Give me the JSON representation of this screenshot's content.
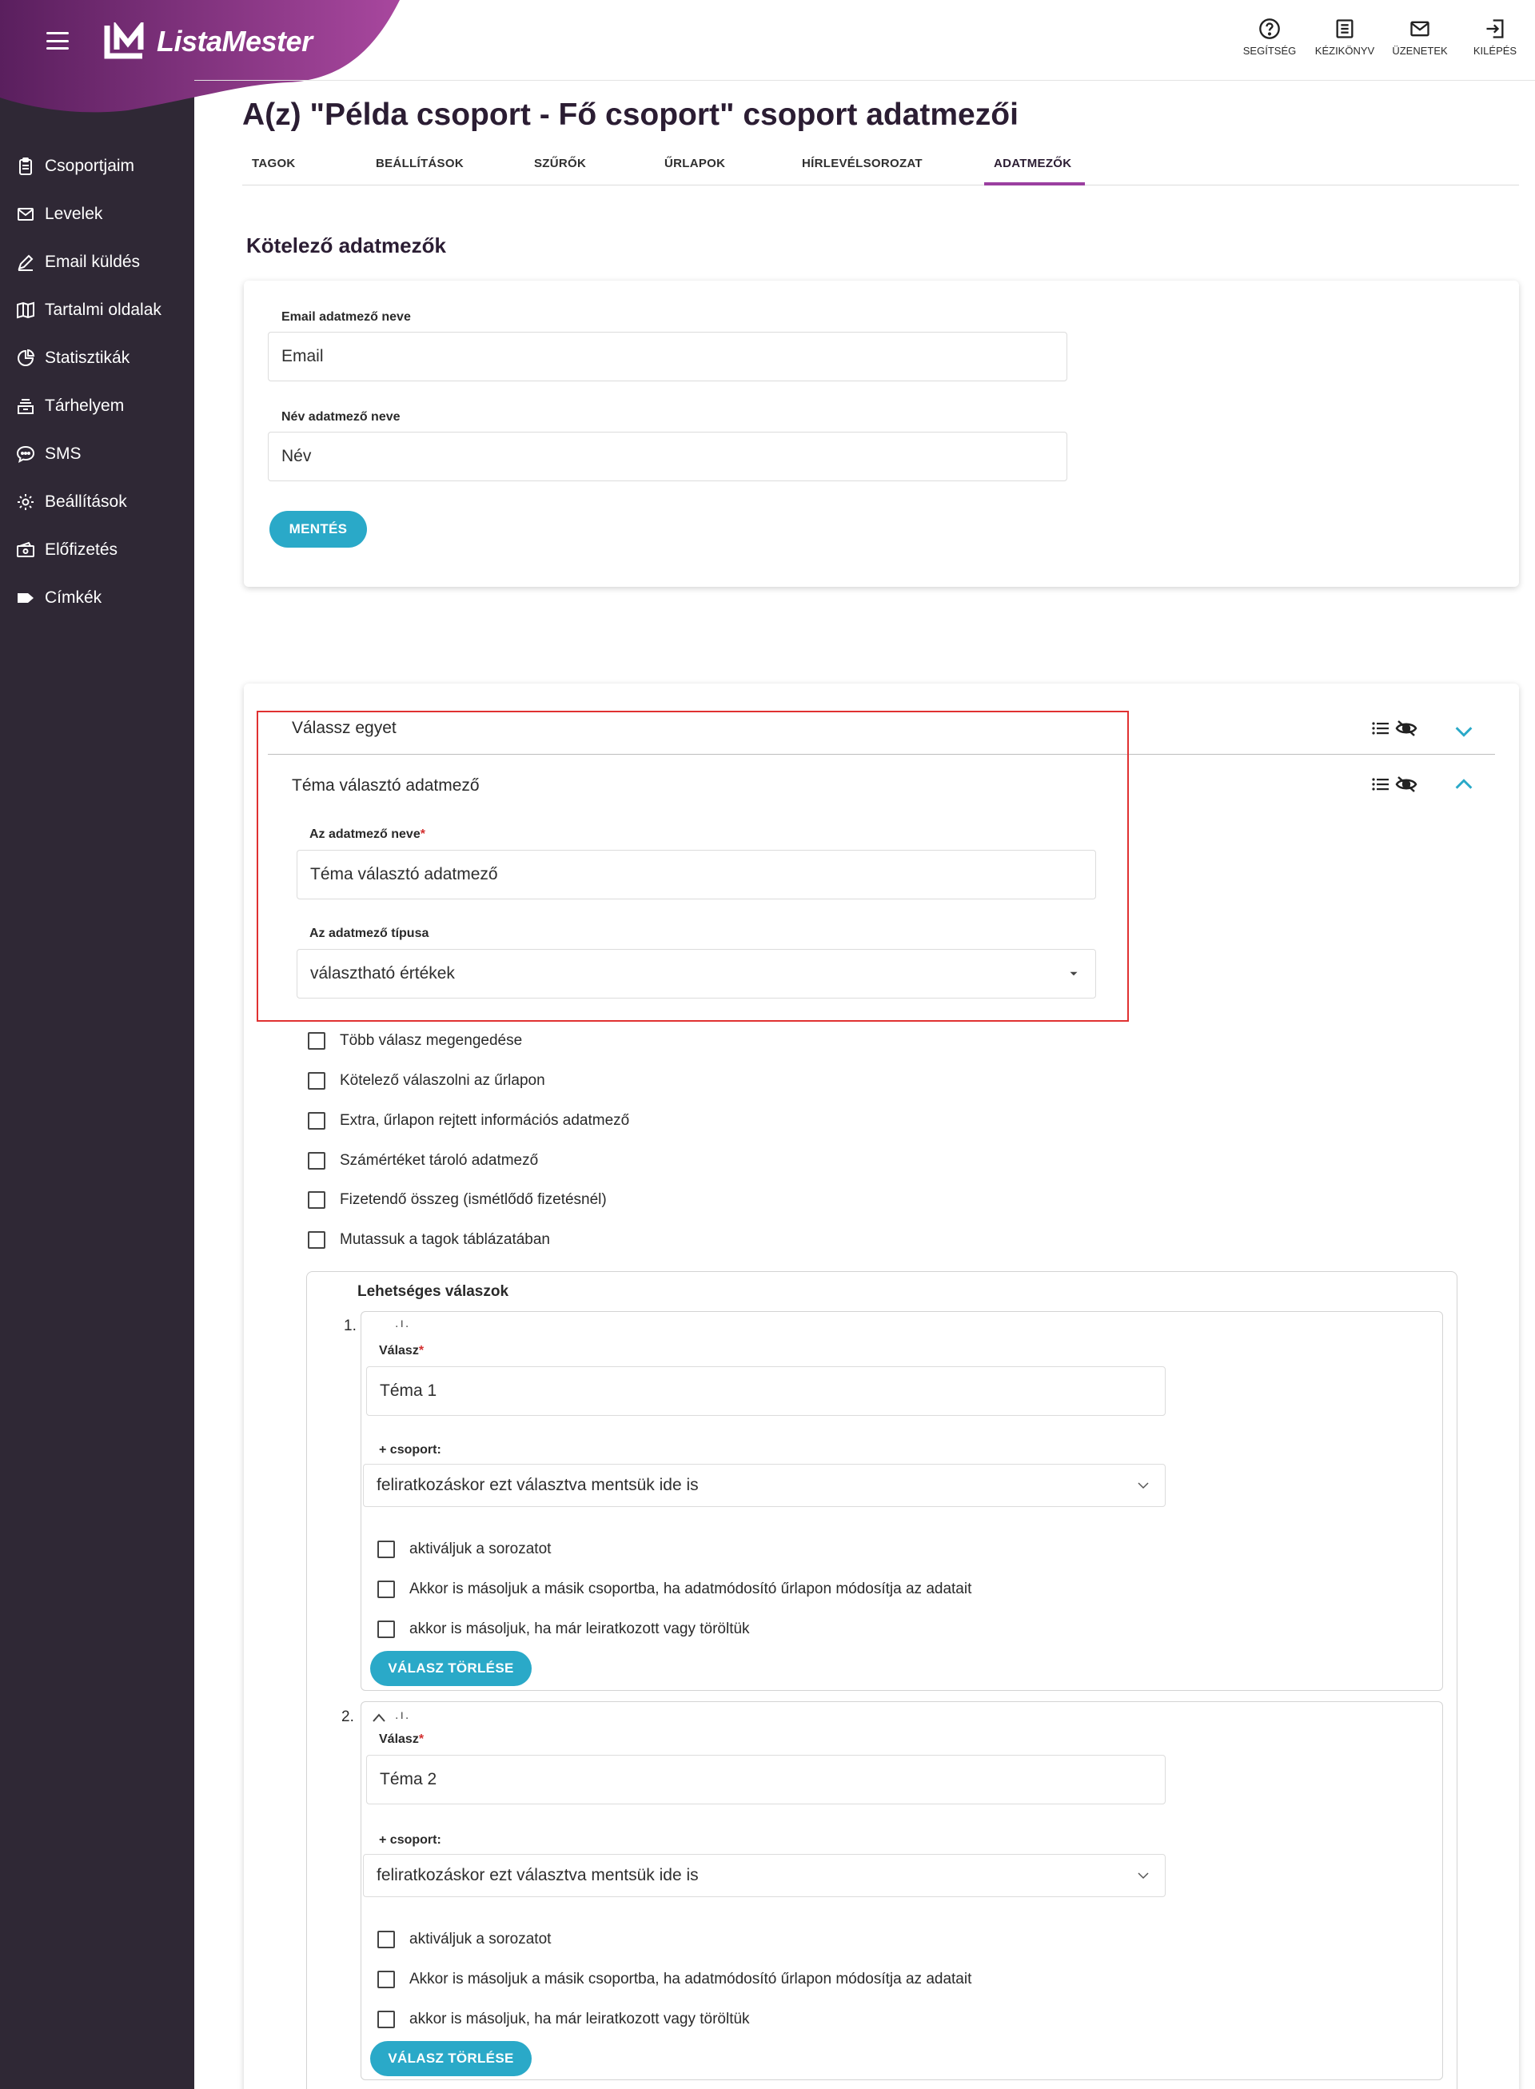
{
  "brand": {
    "name": "ListaMester",
    "colors": {
      "sidebar": "#2f2835",
      "brand_purple": "#9b3fa0",
      "accent": "#2aa9c8",
      "highlight": "#e03131"
    }
  },
  "sidebar": {
    "items": [
      {
        "label": "Csoportjaim",
        "icon": "clipboard-icon"
      },
      {
        "label": "Levelek",
        "icon": "mail-icon"
      },
      {
        "label": "Email küldés",
        "icon": "pen-icon"
      },
      {
        "label": "Tartalmi oldalak",
        "icon": "book-icon"
      },
      {
        "label": "Statisztikák",
        "icon": "pie-chart-icon"
      },
      {
        "label": "Tárhelyem",
        "icon": "storage-icon"
      },
      {
        "label": "SMS",
        "icon": "chat-icon"
      },
      {
        "label": "Beállítások",
        "icon": "gear-icon"
      },
      {
        "label": "Előfizetés",
        "icon": "wallet-icon"
      },
      {
        "label": "Címkék",
        "icon": "tag-icon"
      }
    ]
  },
  "top_actions": [
    {
      "label": "SEGÍTSÉG",
      "icon": "help-icon"
    },
    {
      "label": "KÉZIKÖNYV",
      "icon": "manual-icon"
    },
    {
      "label": "ÜZENETEK",
      "icon": "envelope-icon"
    },
    {
      "label": "KILÉPÉS",
      "icon": "logout-icon"
    }
  ],
  "page": {
    "title": "A(z) \"Példa csoport - Fő csoport\" csoport adatmezői",
    "tabs": [
      {
        "label": "TAGOK",
        "active": false
      },
      {
        "label": "BEÁLLÍTÁSOK",
        "active": false
      },
      {
        "label": "SZŰRŐK",
        "active": false
      },
      {
        "label": "ŰRLAPOK",
        "active": false
      },
      {
        "label": "HÍRLEVÉLSOROZAT",
        "active": false
      },
      {
        "label": "ADATMEZŐK",
        "active": true
      }
    ]
  },
  "required_fields": {
    "section_title": "Kötelező adatmezők",
    "email_label": "Email adatmező neve",
    "email_value": "Email",
    "name_label": "Név adatmező neve",
    "name_value": "Név",
    "save_label": "MENTÉS"
  },
  "custom_fields": {
    "field1_title": "Válassz egyet",
    "field2_title": "Téma választó adatmező",
    "name_label": "Az adatmező neve",
    "name_value": "Téma választó adatmező",
    "type_label": "Az adatmező típusa",
    "type_value": "választható értékek",
    "options": [
      "Több válasz megengedése",
      "Kötelező válaszolni az űrlapon",
      "Extra, űrlapon rejtett információs adatmező",
      "Számértéket tároló adatmező",
      "Fizetendő összeg (ismétlődő fizetésnél)",
      "Mutassuk a tagok táblázatában"
    ]
  },
  "answers": {
    "title": "Lehetséges válaszok",
    "items": [
      {
        "num": "1.",
        "answer_label": "Válasz",
        "answer_value": "Téma 1",
        "group_label": "+ csoport:",
        "group_value": "feliratkozáskor ezt választva mentsük ide is",
        "checks": [
          "aktiváljuk a sorozatot",
          "Akkor is másoljuk a másik csoportba, ha adatmódosító űrlapon módosítja az adatait",
          "akkor is másoljuk, ha már leiratkozott vagy töröltük"
        ],
        "delete_label": "VÁLASZ TÖRLÉSE"
      },
      {
        "num": "2.",
        "answer_label": "Válasz",
        "answer_value": "Téma 2",
        "group_label": "+ csoport:",
        "group_value": "feliratkozáskor ezt választva mentsük ide is",
        "checks": [
          "aktiváljuk a sorozatot",
          "Akkor is másoljuk a másik csoportba, ha adatmódosító űrlapon módosítja az adatait",
          "akkor is másoljuk, ha már leiratkozott vagy töröltük"
        ],
        "delete_label": "VÁLASZ TÖRLÉSE"
      }
    ]
  }
}
